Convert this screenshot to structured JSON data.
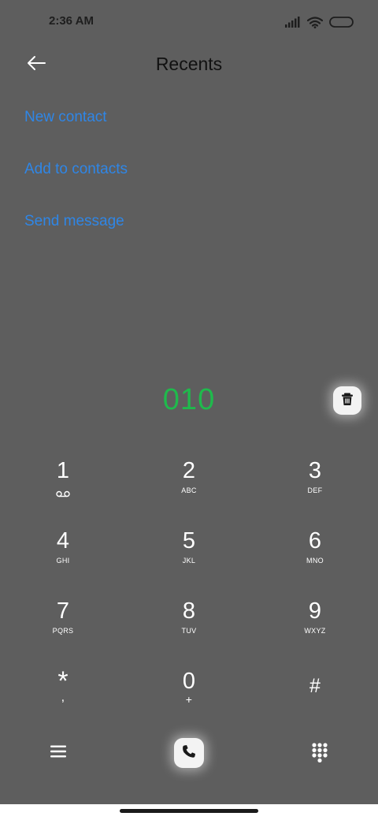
{
  "status_bar": {
    "time": "2:36 AM",
    "icons": [
      "signal-icon",
      "wifi-icon",
      "battery-icon"
    ]
  },
  "header": {
    "back_icon": "back-arrow-icon",
    "title": "Recents"
  },
  "actions": {
    "new_contact": "New contact",
    "add_to_contacts": "Add to contacts",
    "send_message": "Send message"
  },
  "dialer": {
    "number": "010",
    "delete_icon": "trash-icon"
  },
  "keypad": [
    {
      "digit": "1",
      "sub": "voicemail-icon"
    },
    {
      "digit": "2",
      "letters": "ABC"
    },
    {
      "digit": "3",
      "letters": "DEF"
    },
    {
      "digit": "4",
      "letters": "GHI"
    },
    {
      "digit": "5",
      "letters": "JKL"
    },
    {
      "digit": "6",
      "letters": "MNO"
    },
    {
      "digit": "7",
      "letters": "PQRS"
    },
    {
      "digit": "8",
      "letters": "TUV"
    },
    {
      "digit": "9",
      "letters": "WXYZ"
    },
    {
      "digit": "*",
      "letters": ","
    },
    {
      "digit": "0",
      "letters": "+"
    },
    {
      "digit": "#",
      "letters": ""
    }
  ],
  "bottom_bar": {
    "menu_icon": "menu-icon",
    "call_icon": "phone-icon",
    "keypad_icon": "dialpad-icon"
  },
  "colors": {
    "background": "#5e5e5e",
    "link": "#2f86e6",
    "number": "#1fba4c"
  }
}
